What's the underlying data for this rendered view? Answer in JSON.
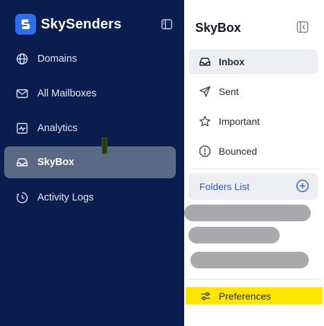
{
  "app": {
    "brand_name": "SkySenders"
  },
  "sidebar": {
    "items": [
      {
        "label": "Domains",
        "icon": "globe-icon",
        "active": false
      },
      {
        "label": "All Mailboxes",
        "icon": "mail-icon",
        "active": false
      },
      {
        "label": "Analytics",
        "icon": "analytics-icon",
        "active": false
      },
      {
        "label": "SkyBox",
        "icon": "inbox-icon",
        "active": true
      },
      {
        "label": "Activity Logs",
        "icon": "clock-icon",
        "active": false
      }
    ]
  },
  "panel": {
    "title": "SkyBox",
    "folders": [
      {
        "label": "Inbox",
        "icon": "inbox-icon",
        "active": true
      },
      {
        "label": "Sent",
        "icon": "send-icon",
        "active": false
      },
      {
        "label": "Important",
        "icon": "star-icon",
        "active": false
      },
      {
        "label": "Bounced",
        "icon": "alert-icon",
        "active": false
      }
    ],
    "folders_list_label": "Folders List",
    "preferences_label": "Preferences"
  },
  "colors": {
    "sidebar_bg": "#091e4e",
    "active_item_bg": "#5a6986",
    "accent": "#2a5bd7",
    "highlight": "#ffe600"
  }
}
